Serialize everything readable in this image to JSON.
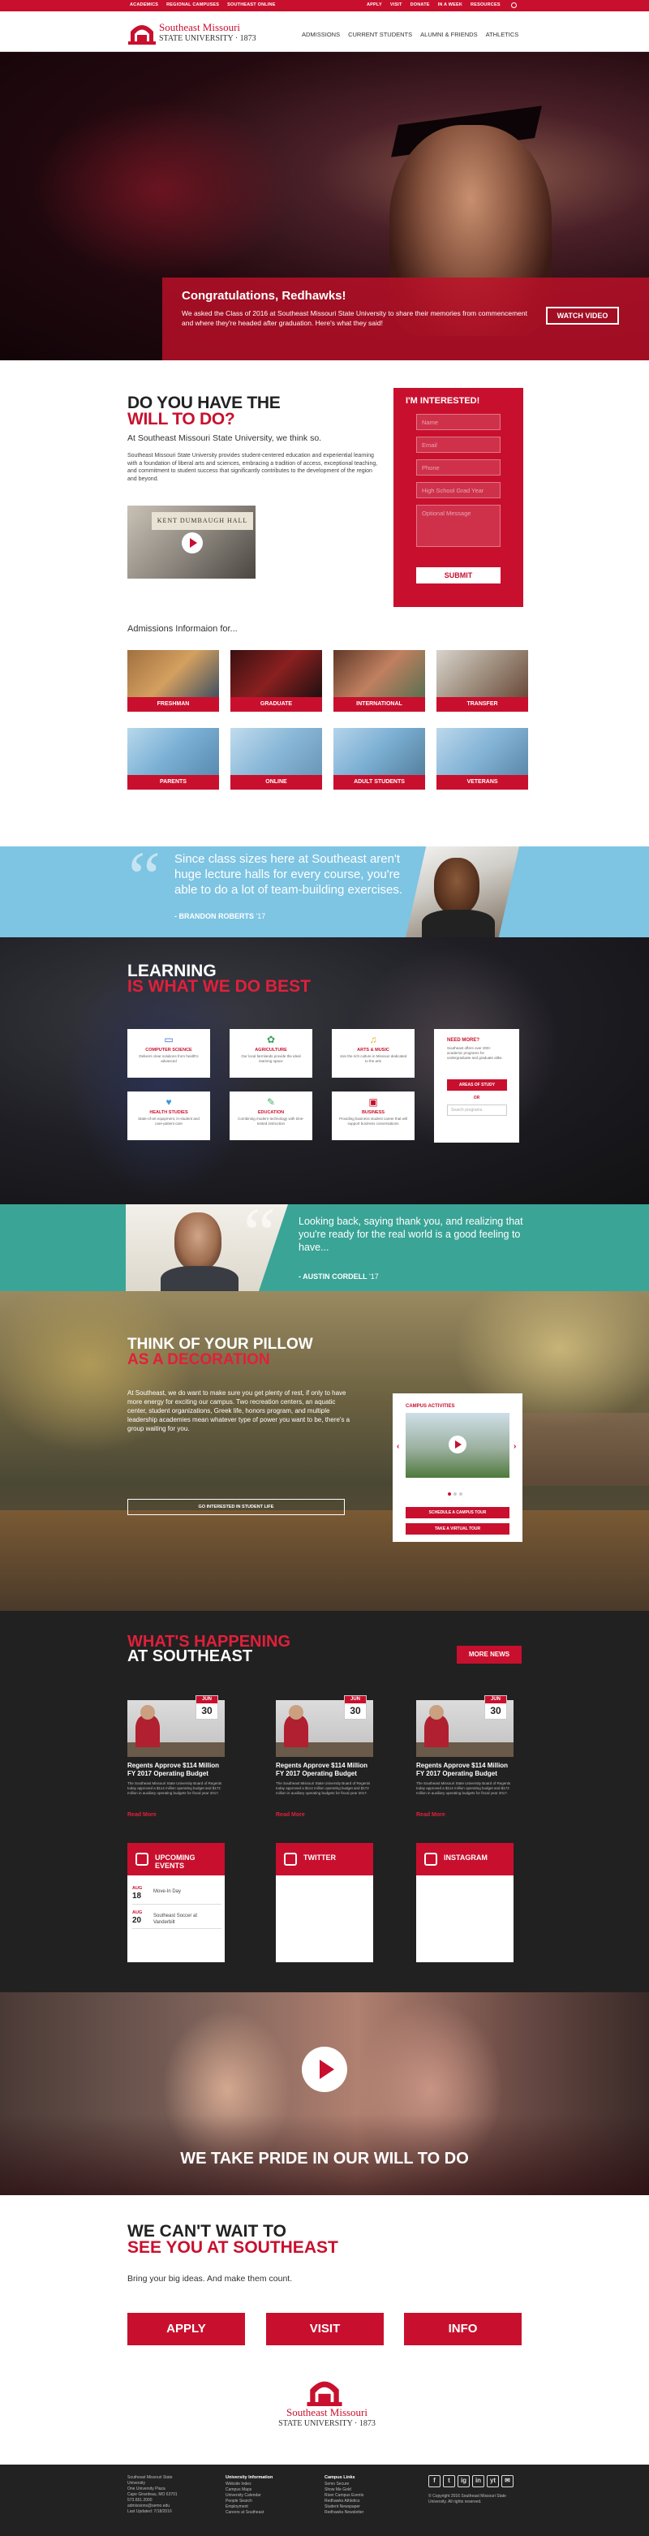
{
  "colors": {
    "brand_red": "#c8102e",
    "sky_blue": "#7ec4e3",
    "teal": "#3aa496",
    "dark": "#212121"
  },
  "utility": {
    "left_links": [
      "ACADEMICS",
      "REGIONAL CAMPUSES",
      "SOUTHEAST ONLINE"
    ],
    "right_links": [
      "APPLY",
      "VISIT",
      "DONATE",
      "IN A WEEK",
      "RESOURCES"
    ],
    "search_icon": "search-icon"
  },
  "header": {
    "logo_line1": "Southeast Missouri",
    "logo_line2": "STATE UNIVERSITY · 1873",
    "nav": [
      "ADMISSIONS",
      "CURRENT STUDENTS",
      "ALUMNI & FRIENDS",
      "ATHLETICS"
    ]
  },
  "hero": {
    "title": "Congratulations, Redhawks!",
    "text": "We asked the Class of 2016 at Southeast Missouri State University to share their memories from commencement and where they're headed after graduation. Here's what they said!",
    "button": "WATCH VIDEO"
  },
  "will": {
    "title_line1": "DO YOU HAVE THE",
    "title_line2": "WILL TO DO?",
    "tagline": "At Southeast Missouri State University, we think so.",
    "description": "Southeast Missouri State University provides student-centered education and experiential learning with a foundation of liberal arts and sciences, embracing a tradition of access, exceptional teaching, and commitment to student success that significantly contributes to the development of the region and beyond.",
    "video_sign": "KENT DUMBAUGH HALL"
  },
  "form": {
    "title": "I'M INTERESTED!",
    "fields": [
      "Name",
      "Email",
      "Phone",
      "High School Grad Year",
      "Optional Message"
    ],
    "submit": "SUBMIT"
  },
  "admissions": {
    "title": "Admissions Informaion for...",
    "tiles": [
      "FRESHMAN",
      "GRADUATE",
      "INTERNATIONAL",
      "TRANSFER",
      "PARENTS",
      "ONLINE",
      "ADULT STUDENTS",
      "VETERANS"
    ]
  },
  "quote1": {
    "text": "Since class sizes here at Southeast aren't huge lecture halls for every course, you're able to do a lot of team-building exercises.",
    "author": "- BRANDON ROBERTS",
    "year": "'17"
  },
  "learning": {
    "title_line1": "LEARNING",
    "title_line2": "IS WHAT WE DO BEST",
    "cards": [
      {
        "icon": "monitor-icon",
        "glyph": "▭",
        "title": "COMPUTER SCIENCE",
        "desc": "Delivers clear solutions from health's advanced"
      },
      {
        "icon": "plant-icon",
        "glyph": "✿",
        "title": "AGRICULTURE",
        "desc": "Our local farmlands provide the ideal learning space"
      },
      {
        "icon": "music-icon",
        "glyph": "♫",
        "title": "ARTS & MUSIC",
        "desc": "Join the rich culture in Missouri dedicated to the arts"
      },
      {
        "icon": "stethoscope-icon",
        "glyph": "♥",
        "title": "HEALTH STUDIES",
        "desc": "State-of-art equipment, in-student and care-patient care"
      },
      {
        "icon": "book-icon",
        "glyph": "✎",
        "title": "EDUCATION",
        "desc": "Combining modern technology with time-tested instruction"
      },
      {
        "icon": "briefcase-icon",
        "glyph": "▣",
        "title": "BUSINESS",
        "desc": "Providing business student career that will support business conversations"
      }
    ],
    "need_title": "NEED MORE?",
    "need_desc": "Southeast offers over 200+ academic programs for undergraduate and graduate alike.",
    "need_button": "AREAS OF STUDY",
    "or": "OR",
    "search_placeholder": "Search programs"
  },
  "quote2": {
    "text": "Looking back, saying thank you, and realizing that you're ready for the real world is a good feeling to have...",
    "author": "- AUSTIN CORDELL",
    "year": "'17"
  },
  "pillow": {
    "title_line1": "THINK OF YOUR PILLOW",
    "title_line2": "AS A DECORATION",
    "text": "At Southeast, we do want to make sure you get plenty of rest, if only to have more energy for exciting our campus. Two recreation centers, an aquatic center, student organizations, Greek life, honors program, and multiple leadership academies mean whatever type of power you want to be, there's a group waiting for you.",
    "button": "GO INTERESTED IN STUDENT LIFE",
    "slider_title": "CAMPUS ACTIVITIES",
    "slider_b1": "SCHEDULE A CAMPUS TOUR",
    "slider_b2": "TAKE A VIRTUAL TOUR"
  },
  "happening": {
    "title_line1": "WHAT'S HAPPENING",
    "title_line2": "AT SOUTHEAST",
    "more": "MORE NEWS",
    "news": [
      {
        "month": "JUN",
        "day": "30",
        "title": "Regents Approve $114 Million FY 2017 Operating Budget",
        "excerpt": "The Southeast Missouri State University Board of Regents today approved a $114 million operating budget and $172 million in auxiliary operating budgets for fiscal year 2017.",
        "read_more": "Read More"
      },
      {
        "month": "JUN",
        "day": "30",
        "title": "Regents Approve $114 Million FY 2017 Operating Budget",
        "excerpt": "The Southeast Missouri State University Board of Regents today approved a $114 million operating budget and $172 million in auxiliary operating budgets for fiscal year 2017.",
        "read_more": "Read More"
      },
      {
        "month": "JUN",
        "day": "30",
        "title": "Regents Approve $114 Million FY 2017 Operating Budget",
        "excerpt": "The Southeast Missouri State University Board of Regents today approved a $114 million operating budget and $172 million in auxiliary operating budgets for fiscal year 2017.",
        "read_more": "Read More"
      }
    ],
    "events_title": "UPCOMING EVENTS",
    "events": [
      {
        "month": "AUG",
        "day": "18",
        "name": "Move-In Day"
      },
      {
        "month": "AUG",
        "day": "20",
        "name": "Southeast Soccer at Vanderbilt"
      }
    ],
    "twitter": "TWITTER",
    "instagram": "INSTAGRAM"
  },
  "pride": {
    "title": "WE TAKE PRIDE IN OUR WILL TO DO"
  },
  "see": {
    "title_line1": "WE CAN'T WAIT TO",
    "title_line2": "SEE YOU AT SOUTHEAST",
    "sub": "Bring your big ideas. And make them count.",
    "buttons": [
      "APPLY",
      "VISIT",
      "INFO"
    ]
  },
  "footer_logo": {
    "line1": "Southeast Missouri",
    "line2": "STATE UNIVERSITY · 1873"
  },
  "footer": {
    "address": [
      "Southeast Missouri State",
      "University",
      "One University Plaza",
      "Cape Girardeau, MO 63701",
      "573.651.2000",
      "admissions@semo.edu",
      "Last Updated: 7/18/2016"
    ],
    "info_title": "University Information",
    "info_links": [
      "Website Index",
      "Campus Maps",
      "University Calendar",
      "People Search",
      "Employment",
      "Careers at Southeast"
    ],
    "campus_title": "Campus Links",
    "campus_links": [
      "Semo Secure",
      "Show Me Gold",
      "River Campus Events",
      "Redhawks Athletics",
      "Student Newspaper",
      "Redhawks Newsletter"
    ],
    "social": [
      "f",
      "t",
      "ig",
      "in",
      "yt",
      "✉"
    ],
    "copyright": "© Copyright 2016 Southeast Missouri State University. All rights reserved."
  }
}
